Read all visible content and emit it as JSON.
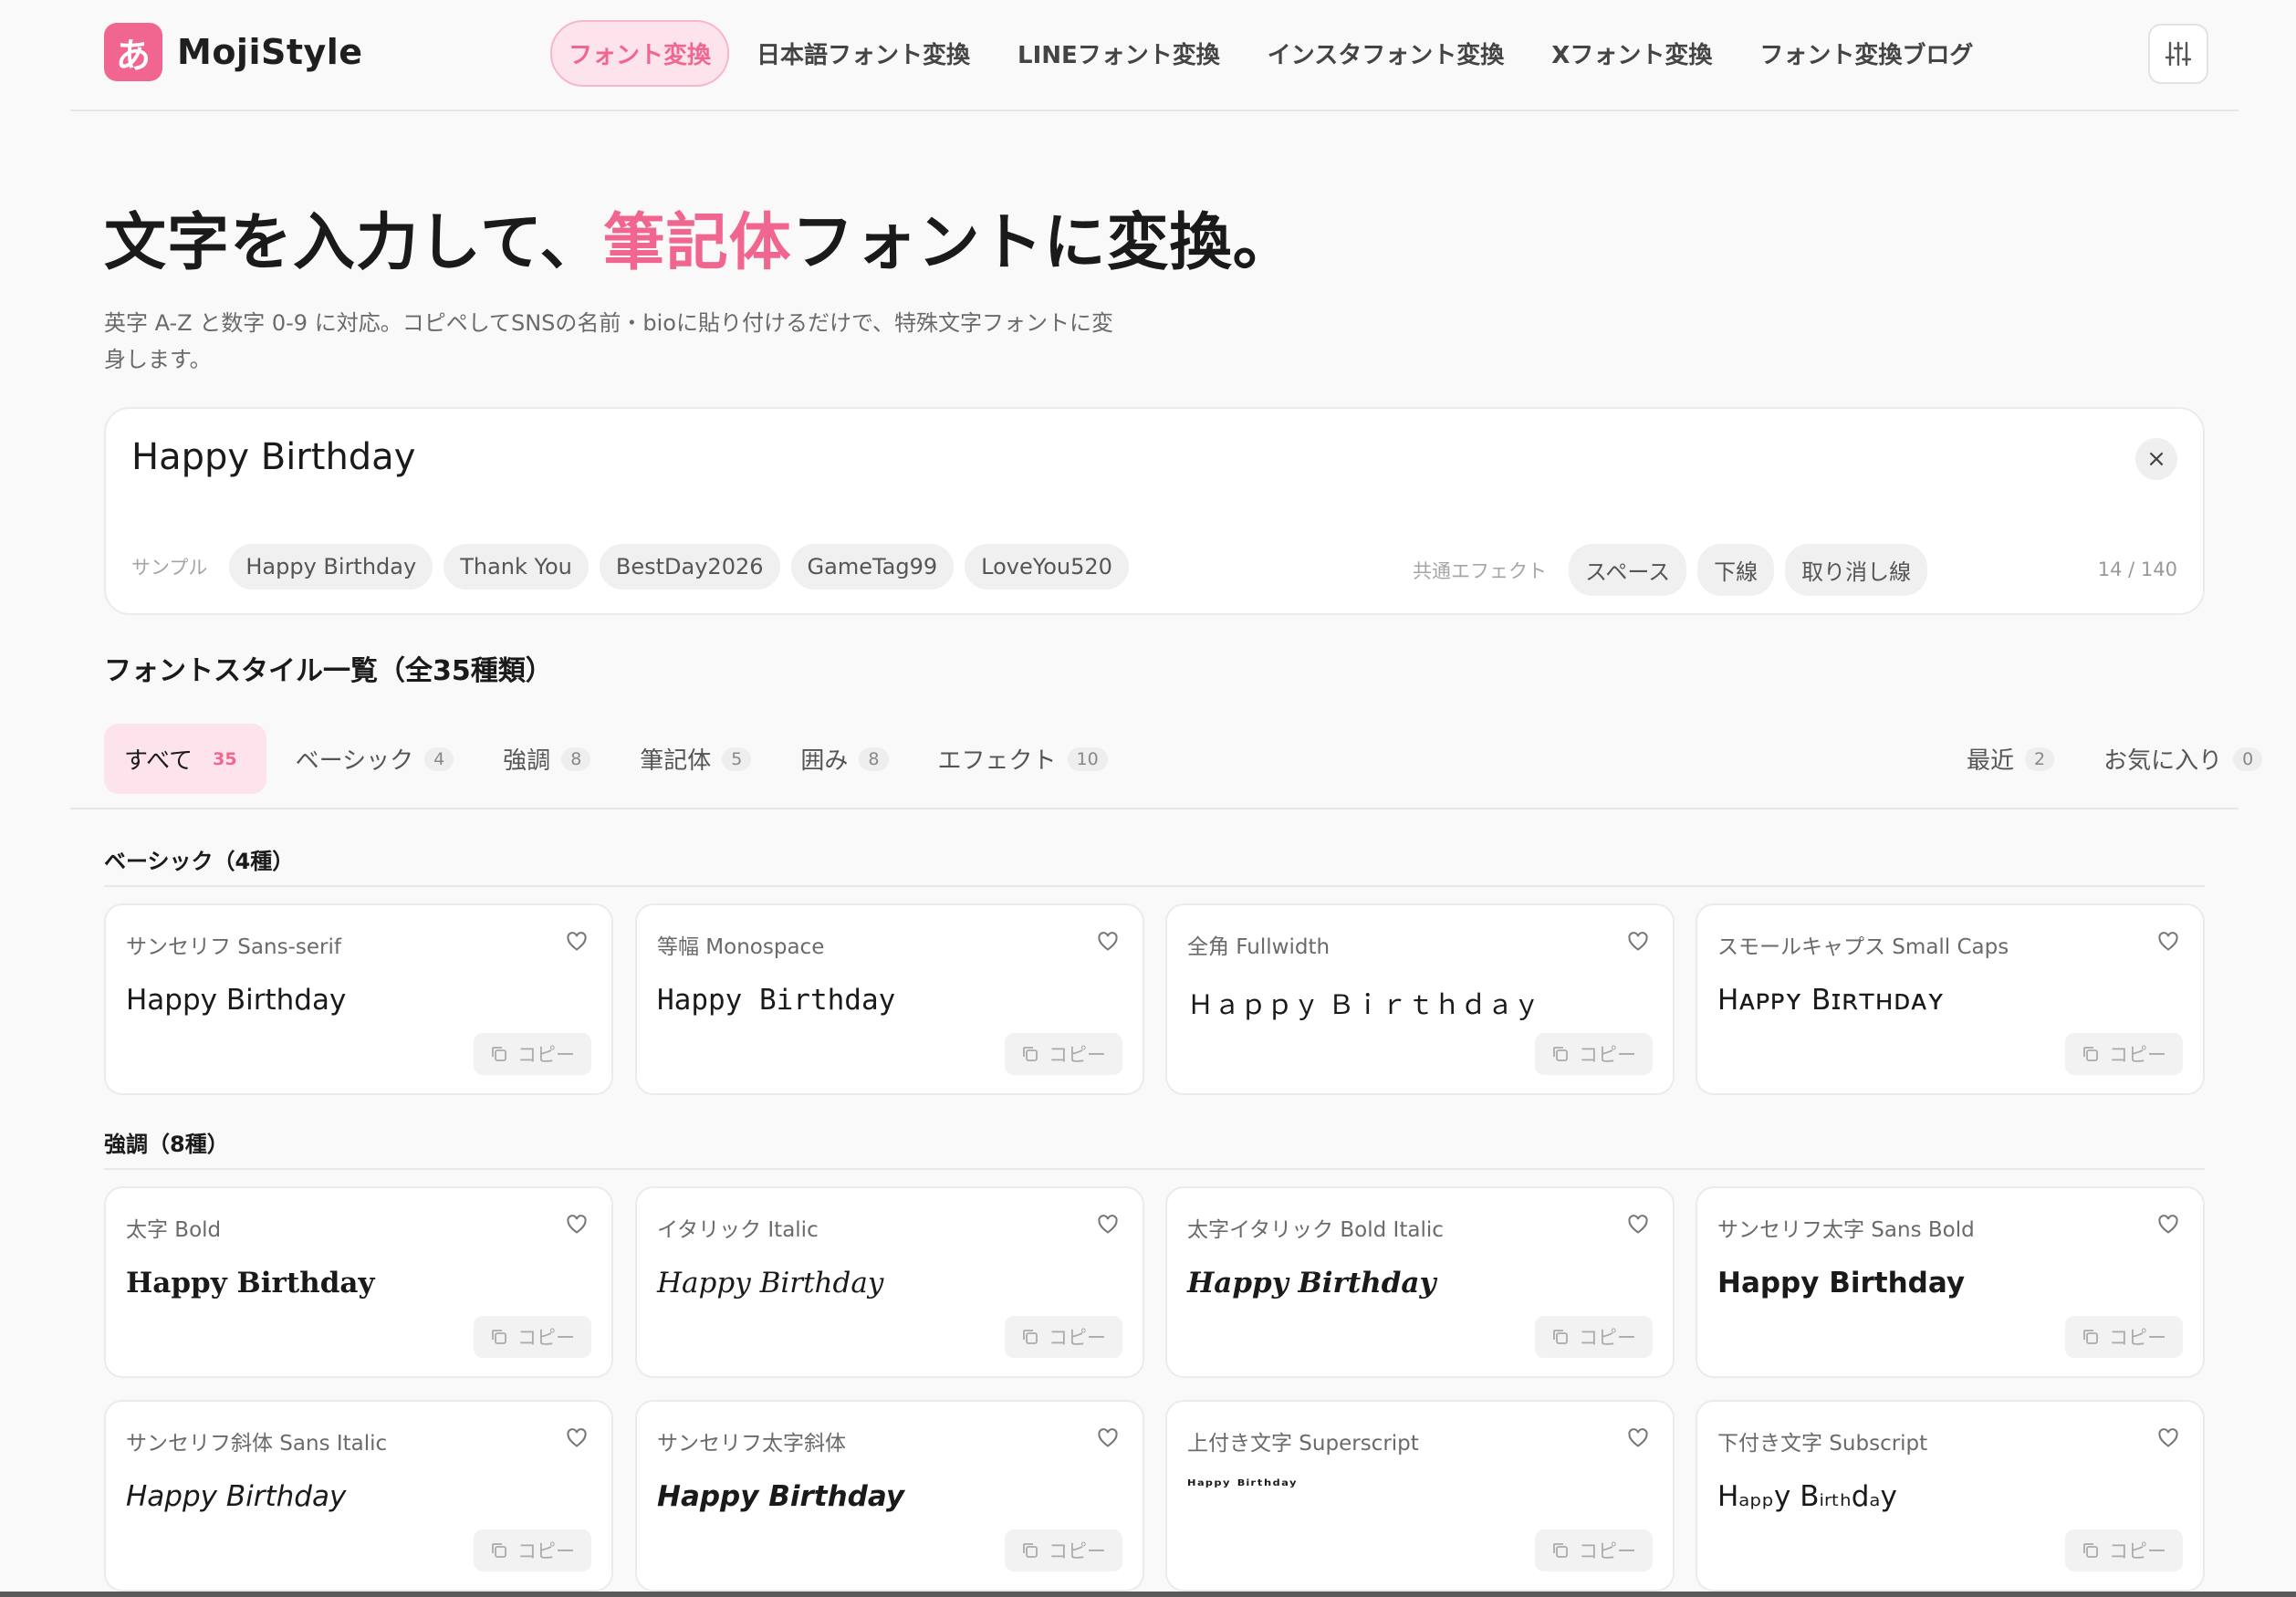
{
  "brand": {
    "logo_char": "あ",
    "name": "MojiStyle",
    "accent": "#f0668f"
  },
  "nav": [
    {
      "label": "フォント変換",
      "active": true
    },
    {
      "label": "日本語フォント変換"
    },
    {
      "label": "LINEフォント変換"
    },
    {
      "label": "インスタフォント変換"
    },
    {
      "label": "Xフォント変換"
    },
    {
      "label": "フォント変換ブログ"
    }
  ],
  "hero": {
    "title_before": "文字を入力して、",
    "title_accent": "筆記体",
    "title_after": "フォントに変換。",
    "description": "英字 A-Z と数字 0-9 に対応。コピペしてSNSの名前・bioに貼り付けるだけで、特殊文字フォントに変身します。"
  },
  "input": {
    "value": "Happy Birthday",
    "clear_symbol": "×",
    "samples_label": "サンプル",
    "samples": [
      "Happy Birthday",
      "Thank You",
      "BestDay2026",
      "GameTag99",
      "LoveYou520"
    ],
    "effects_label": "共通エフェクト",
    "effects": [
      "スペース",
      "下線",
      "取り消し線"
    ],
    "counter": "14 / 140"
  },
  "list": {
    "title": "フォントスタイル一覧（全35種類）",
    "tabs": [
      {
        "label": "すべて",
        "count": "35",
        "active": true
      },
      {
        "label": "ベーシック",
        "count": "4"
      },
      {
        "label": "強調",
        "count": "8"
      },
      {
        "label": "筆記体",
        "count": "5"
      },
      {
        "label": "囲み",
        "count": "8"
      },
      {
        "label": "エフェクト",
        "count": "10"
      }
    ],
    "tabs_right": [
      {
        "label": "最近",
        "count": "2"
      },
      {
        "label": "お気に入り",
        "count": "0"
      }
    ]
  },
  "copy_label": "コピー",
  "sections": [
    {
      "title": "ベーシック（4種）",
      "cards": [
        {
          "label": "サンセリフ Sans-serif",
          "preview": "Happy Birthday"
        },
        {
          "label": "等幅 Monospace",
          "preview": "Happy Birthday"
        },
        {
          "label": "全角 Fullwidth",
          "preview": "Ｈａｐｐｙ Ｂｉｒｔｈｄａｙ"
        },
        {
          "label": "スモールキャプス Small Caps",
          "preview": "Hᴀᴘᴘʏ Bɪʀᴛʜᴅᴀʏ"
        }
      ]
    },
    {
      "title": "強調（8種）",
      "cards": [
        {
          "label": "太字 Bold",
          "preview": "Happy Birthday"
        },
        {
          "label": "イタリック Italic",
          "preview": "Happy Birthday"
        },
        {
          "label": "太字イタリック Bold Italic",
          "preview": "Happy Birthday"
        },
        {
          "label": "サンセリフ太字 Sans Bold",
          "preview": "Happy Birthday"
        },
        {
          "label": "サンセリフ斜体 Sans Italic",
          "preview": "Happy Birthday"
        },
        {
          "label": "サンセリフ太字斜体",
          "preview": "Happy Birthday"
        },
        {
          "label": "上付き文字 Superscript",
          "preview": "ᴴᵃᵖᵖʸ ᴮⁱʳᵗʰᵈᵃʸ"
        },
        {
          "label": "下付き文字 Subscript",
          "preview": "Hₐₚₚy Bᵢᵣₜₕdₐy"
        }
      ]
    }
  ]
}
